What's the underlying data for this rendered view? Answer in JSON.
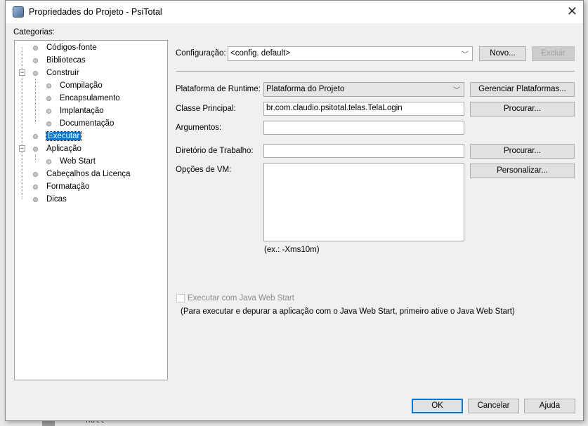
{
  "window": {
    "title": "Propriedades do Projeto - PsiTotal",
    "close": "✕"
  },
  "background": {
    "code_text": "null"
  },
  "categories": {
    "label": "Categorias:",
    "items": [
      {
        "label": "Códigos-fonte"
      },
      {
        "label": "Bibliotecas"
      },
      {
        "label": "Construir"
      },
      {
        "label": "Compilação"
      },
      {
        "label": "Encapsulamento"
      },
      {
        "label": "Implantação"
      },
      {
        "label": "Documentação"
      },
      {
        "label": "Executar"
      },
      {
        "label": "Aplicação"
      },
      {
        "label": "Web Start"
      },
      {
        "label": "Cabeçalhos da Licença"
      },
      {
        "label": "Formatação"
      },
      {
        "label": "Dicas"
      }
    ],
    "selected": "Executar"
  },
  "config": {
    "label": "Configuração:",
    "value": "<config. default>",
    "new": "Novo...",
    "delete": "Excluir"
  },
  "form": {
    "runtime_label": "Plataforma de Runtime:",
    "runtime_value": "Plataforma do Projeto",
    "manage": "Gerenciar Plataformas...",
    "main_class_label": "Classe Principal:",
    "main_class_value": "br.com.claudio.psitotal.telas.TelaLogin",
    "browse1": "Procurar...",
    "args_label": "Argumentos:",
    "args_value": "",
    "workdir_label": "Diretório de Trabalho:",
    "workdir_value": "",
    "browse2": "Procurar...",
    "vm_label": "Opções de VM:",
    "vm_value": "",
    "customize": "Personalizar...",
    "vm_hint": "(ex.: -Xms10m)",
    "webstart_check": "Executar com Java Web Start",
    "webstart_checked": false,
    "webstart_note": "(Para executar e depurar a aplicação com o Java Web Start, primeiro ative o Java Web Start)"
  },
  "footer": {
    "ok": "OK",
    "cancel": "Cancelar",
    "help": "Ajuda"
  }
}
